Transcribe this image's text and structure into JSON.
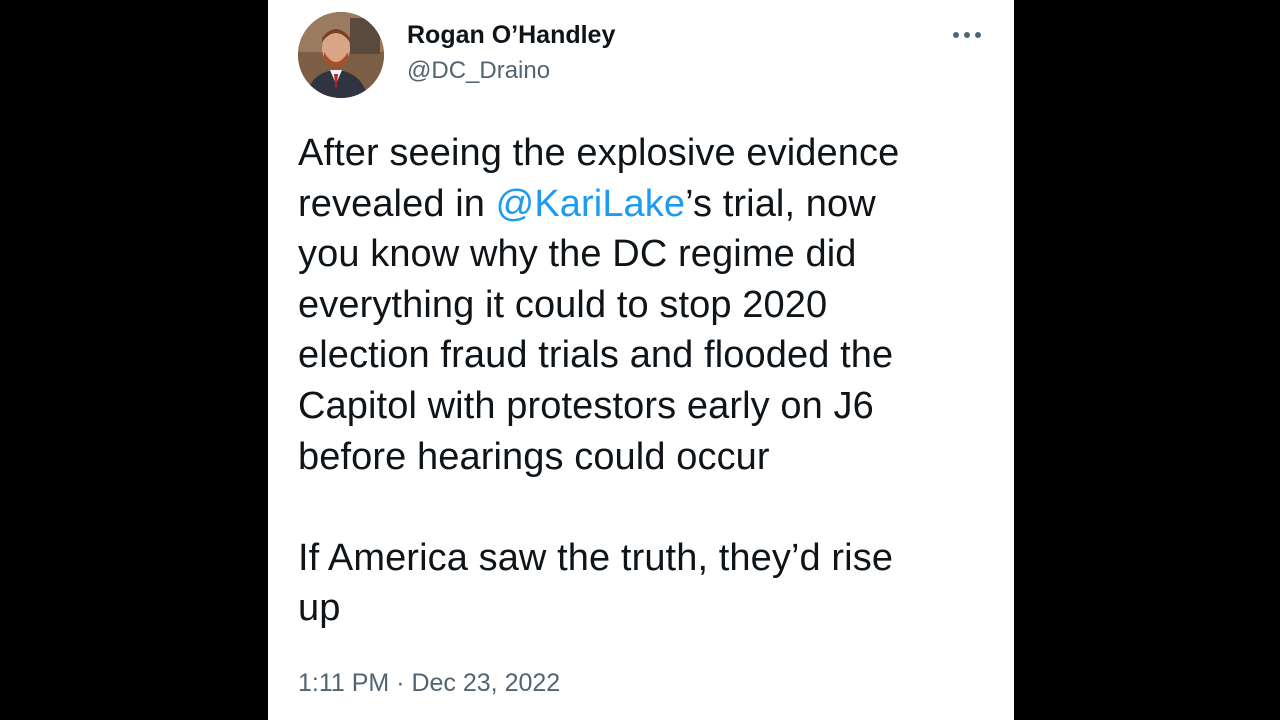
{
  "author": {
    "display_name": "Rogan O’Handley",
    "handle": "@DC_Draino",
    "avatar_icon": "profile-photo"
  },
  "more_icon": "more-dots-icon",
  "tweet": {
    "lines": [
      {
        "text": "After seeing the explosive evidence"
      },
      {
        "before": "revealed in ",
        "mention": "@KariLake",
        "after": "’s trial, now"
      },
      {
        "text": "you know why the DC regime did"
      },
      {
        "text": "everything it could to stop 2020"
      },
      {
        "text": "election fraud trials and flooded the"
      },
      {
        "text": "Capitol with protestors early on J6"
      },
      {
        "text": "before hearings could occur"
      },
      {
        "text": "If America saw the truth, they’d rise"
      },
      {
        "text": "up"
      }
    ]
  },
  "meta": {
    "time": "1:11 PM",
    "separator": " · ",
    "date": "Dec 23, 2022"
  },
  "colors": {
    "mention": "#1d9bf0",
    "secondary_text": "#536471",
    "primary_text": "#0f1419",
    "background_bars": "#000000"
  }
}
